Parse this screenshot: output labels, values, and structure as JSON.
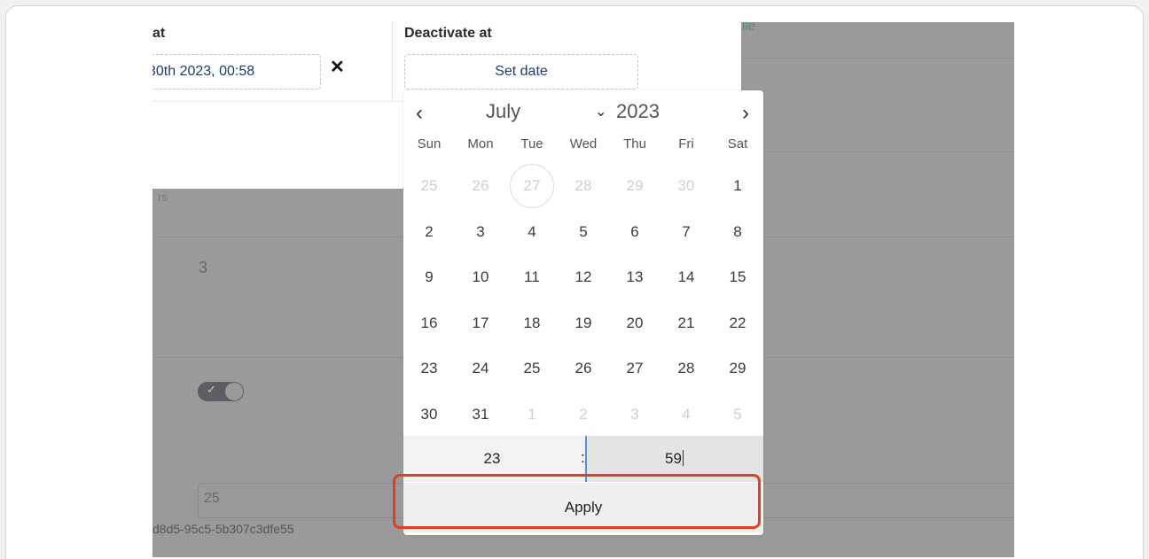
{
  "background": {
    "link_fragment": "lle",
    "label_fragment": "rs",
    "number_value": "3",
    "input_value": "25",
    "uuid_fragment": "d8d5-95c5-5b307c3dfe55",
    "toggle_checked": true
  },
  "dialog": {
    "activate_label": "at",
    "activate_value": "30th 2023, 00:58",
    "clear_icon": "✕",
    "deactivate_label": "Deactivate at",
    "deactivate_value": "Set date"
  },
  "calendar": {
    "prev_icon": "‹",
    "next_icon": "›",
    "month": "July",
    "month_chevron": "⌄",
    "year": "2023",
    "weekdays": [
      "Sun",
      "Mon",
      "Tue",
      "Wed",
      "Thu",
      "Fri",
      "Sat"
    ],
    "weeks": [
      [
        "25",
        "26",
        "27",
        "28",
        "29",
        "30",
        "1"
      ],
      [
        "2",
        "3",
        "4",
        "5",
        "6",
        "7",
        "8"
      ],
      [
        "9",
        "10",
        "11",
        "12",
        "13",
        "14",
        "15"
      ],
      [
        "16",
        "17",
        "18",
        "19",
        "20",
        "21",
        "22"
      ],
      [
        "23",
        "24",
        "25",
        "26",
        "27",
        "28",
        "29"
      ],
      [
        "30",
        "31",
        "1",
        "2",
        "3",
        "4",
        "5"
      ]
    ],
    "outside_month_cells": [
      "0-0",
      "0-1",
      "0-2",
      "0-3",
      "0-4",
      "0-5",
      "5-2",
      "5-3",
      "5-4",
      "5-5",
      "5-6"
    ],
    "today_cell": "0-2",
    "hour": "23",
    "separator": ":",
    "minute": "59",
    "apply_label": "Apply"
  },
  "colors": {
    "highlight": "#e0401f",
    "overlay": "#9a9a9a",
    "link": "#4f8a88",
    "date_text": "#223a6b"
  }
}
